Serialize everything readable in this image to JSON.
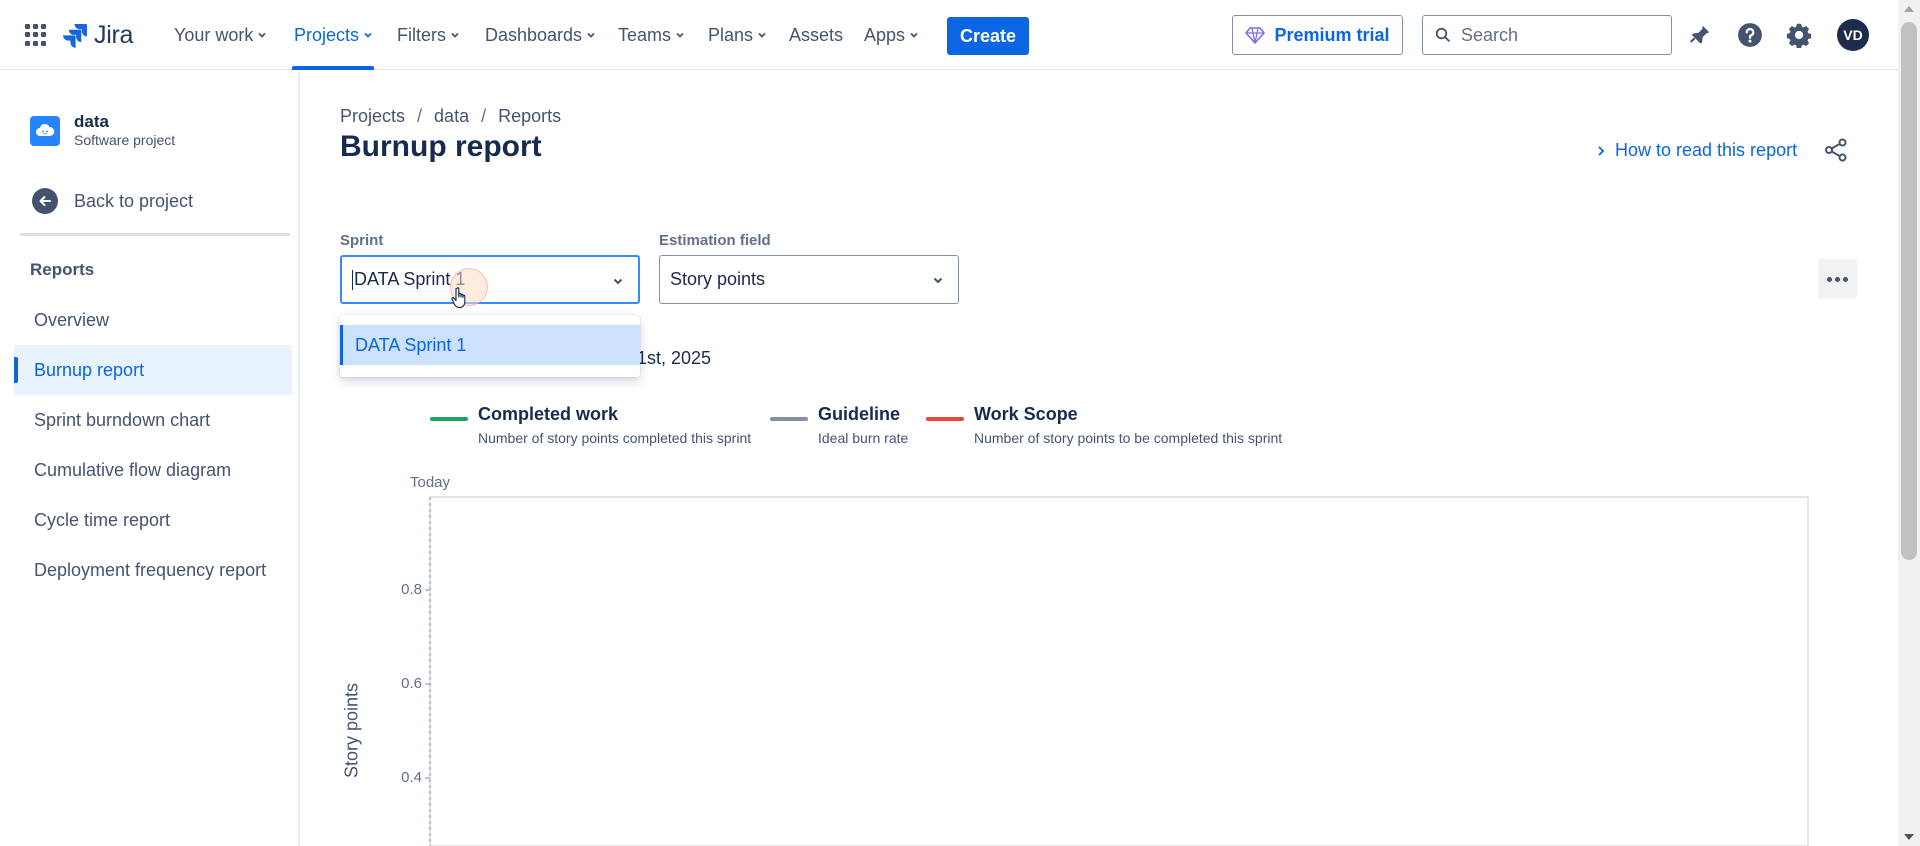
{
  "topnav": {
    "logo_text": "Jira",
    "items": [
      {
        "label": "Your work",
        "has_chevron": true,
        "active": false
      },
      {
        "label": "Projects",
        "has_chevron": true,
        "active": true
      },
      {
        "label": "Filters",
        "has_chevron": true,
        "active": false
      },
      {
        "label": "Dashboards",
        "has_chevron": true,
        "active": false
      },
      {
        "label": "Teams",
        "has_chevron": true,
        "active": false
      },
      {
        "label": "Plans",
        "has_chevron": true,
        "active": false
      },
      {
        "label": "Assets",
        "has_chevron": false,
        "active": false
      },
      {
        "label": "Apps",
        "has_chevron": true,
        "active": false
      }
    ],
    "create_label": "Create",
    "premium_label": "Premium trial",
    "search_placeholder": "Search",
    "avatar_initials": "VD",
    "icons": [
      "app-switcher-icon",
      "notifications-icon",
      "help-icon",
      "settings-icon"
    ]
  },
  "sidebar": {
    "project_name": "data",
    "project_type": "Software project",
    "back_label": "Back to project",
    "section_heading": "Reports",
    "items": [
      {
        "label": "Overview",
        "active": false
      },
      {
        "label": "Burnup report",
        "active": true
      },
      {
        "label": "Sprint burndown chart",
        "active": false
      },
      {
        "label": "Cumulative flow diagram",
        "active": false
      },
      {
        "label": "Cycle time report",
        "active": false
      },
      {
        "label": "Deployment frequency report",
        "active": false
      }
    ]
  },
  "main": {
    "breadcrumb": [
      "Projects",
      "data",
      "Reports"
    ],
    "title": "Burnup report",
    "how_to_read": "How to read this report",
    "sprint_label": "Sprint",
    "sprint_value": "DATA Sprint 1",
    "estimation_label": "Estimation field",
    "estimation_value": "Story points",
    "dropdown_options": [
      "DATA Sprint 1"
    ],
    "date_partial": "1st, 2025"
  },
  "legend": [
    {
      "title": "Completed work",
      "desc": "Number of story points completed this sprint",
      "color": "#22a06b"
    },
    {
      "title": "Guideline",
      "desc": "Ideal burn rate",
      "color": "#8590a2"
    },
    {
      "title": "Work Scope",
      "desc": "Number of story points to be completed this sprint",
      "color": "#e2483d"
    }
  ],
  "chart_data": {
    "type": "line",
    "ylabel": "Story points",
    "today_label": "Today",
    "y_ticks": [
      "0.8",
      "0.6",
      "0.4"
    ],
    "ylim": [
      0,
      1
    ],
    "series": []
  },
  "colors": {
    "accent": "#0c66e4",
    "selected_bg": "#e9f2ff",
    "option_bg": "#cce0ff"
  }
}
